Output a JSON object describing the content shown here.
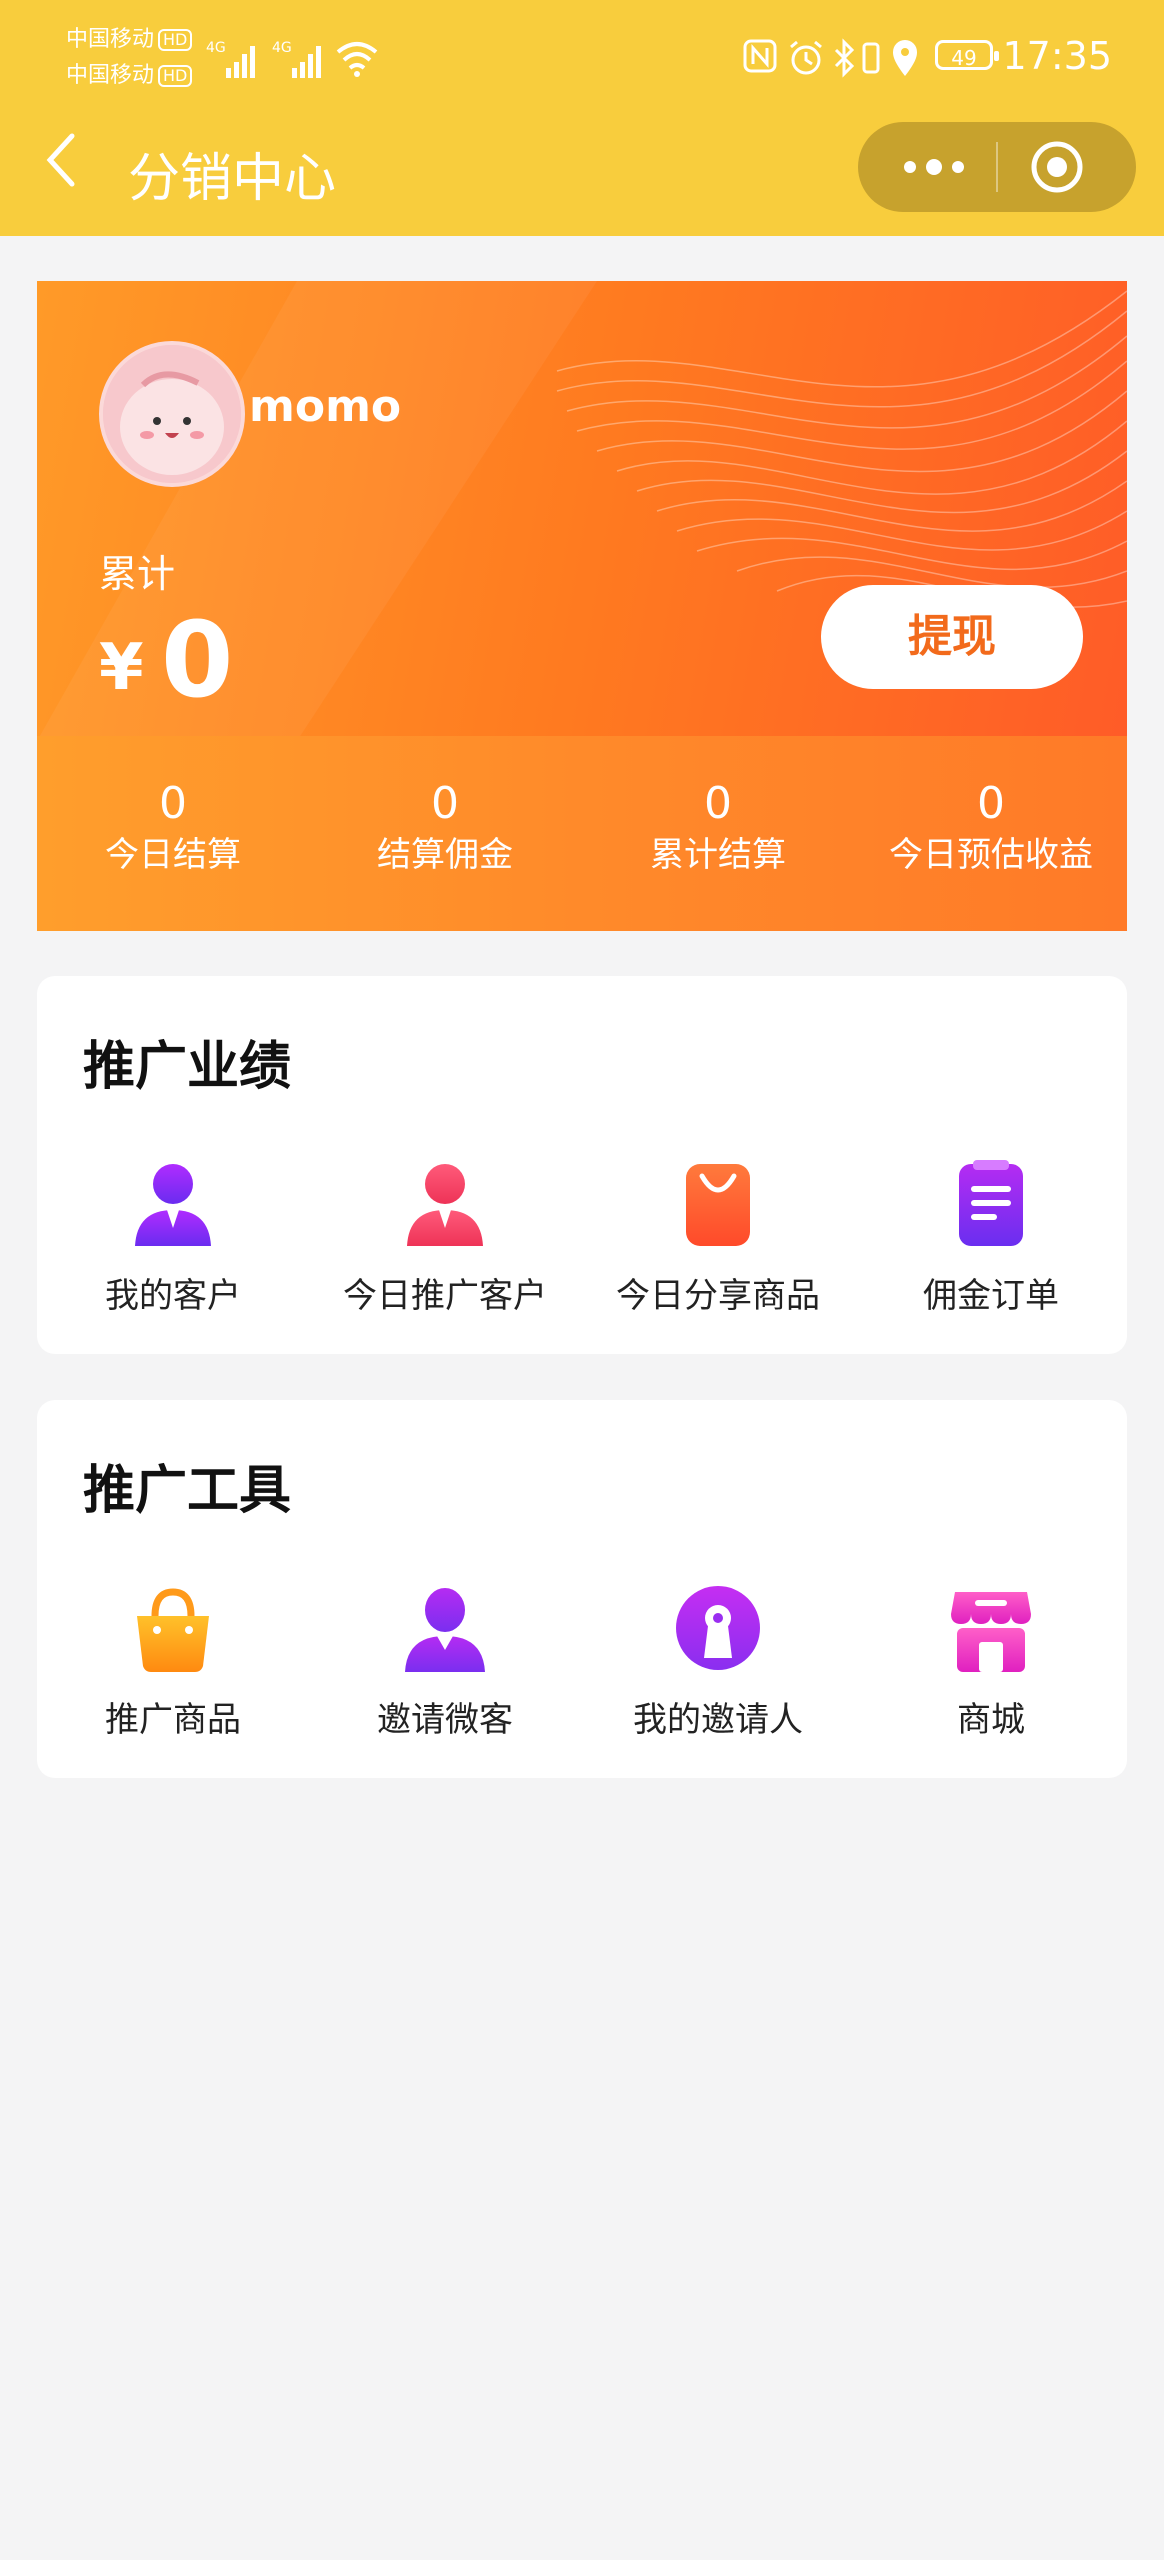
{
  "status_bar": {
    "carrier1": "中国移动",
    "carrier2": "中国移动",
    "hd": "HD",
    "network": "4G",
    "battery": "49",
    "time": "17:35"
  },
  "nav": {
    "title": "分销中心"
  },
  "hero": {
    "username": "momo",
    "cumulative_label": "累计",
    "currency": "¥",
    "amount": "0",
    "withdraw_label": "提现",
    "stats": [
      {
        "value": "0",
        "label": "今日结算"
      },
      {
        "value": "0",
        "label": "结算佣金"
      },
      {
        "value": "0",
        "label": "累计结算"
      },
      {
        "value": "0",
        "label": "今日预估收益"
      }
    ]
  },
  "performance": {
    "title": "推广业绩",
    "items": [
      {
        "label": "我的客户",
        "icon": "person-icon"
      },
      {
        "label": "今日推广客户",
        "icon": "person-icon"
      },
      {
        "label": "今日分享商品",
        "icon": "shopping-bag-icon"
      },
      {
        "label": "佣金订单",
        "icon": "clipboard-icon"
      }
    ]
  },
  "tools": {
    "title": "推广工具",
    "items": [
      {
        "label": "推广商品",
        "icon": "basket-icon"
      },
      {
        "label": "邀请微客",
        "icon": "person-icon"
      },
      {
        "label": "我的邀请人",
        "icon": "keyhole-icon"
      },
      {
        "label": "商城",
        "icon": "store-icon"
      }
    ]
  },
  "colors": {
    "header": "#f8cd3d",
    "hero_orange": "#ff7a20",
    "withdraw_text": "#f26a1b"
  }
}
